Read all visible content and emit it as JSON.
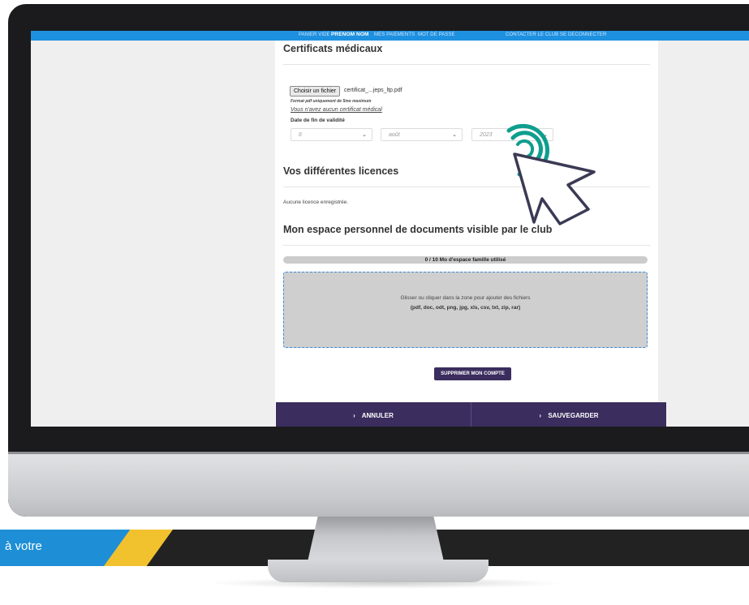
{
  "topbar": {
    "panier": "PANIER VIDE",
    "user": "PRENOM NOM",
    "paiements": "MES PAIEMENTS",
    "motdepasse": "MOT DE PASSE",
    "contacter": "CONTACTER LE CLUB",
    "deconnecter": "SE DECONNECTER"
  },
  "certificats": {
    "title": "Certificats médicaux",
    "file_button": "Choisir un fichier",
    "file_name": "certificat_...jeps_ltp.pdf",
    "format_note": "Format pdf uniquement de 5mo maximum",
    "no_cert_link": "Vous n'avez aucun certificat médical",
    "date_label": "Date de fin de validité",
    "day_value": "6",
    "month_value": "août",
    "year_value": "2023"
  },
  "licences": {
    "title": "Vos différentes licences",
    "empty_text": "Aucune licence enregistrée."
  },
  "documents": {
    "title": "Mon espace personnel de documents visible par le club",
    "usage_text": "0 / 10 Mo d'espace famille utilisé",
    "usage_fraction": 0,
    "dropzone_line1": "Glisser ou cliquer dans la zone pour ajouter des fichiers",
    "dropzone_line2": "(pdf, doc, odt, png, jpg, xls, csv, txt, zip, rar)"
  },
  "actions": {
    "delete_account": "SUPPRIMER MON COMPTE",
    "cancel": "ANNULER",
    "save": "SAUVEGARDER",
    "chevron": "›"
  },
  "banner": {
    "text": "à votre"
  },
  "colors": {
    "topbar": "#1e90e0",
    "primary_purple": "#3b2d5e",
    "cursor_teal": "#0e9e8e",
    "banner_blue": "#1e8fd6",
    "banner_yellow": "#f2c12e"
  }
}
